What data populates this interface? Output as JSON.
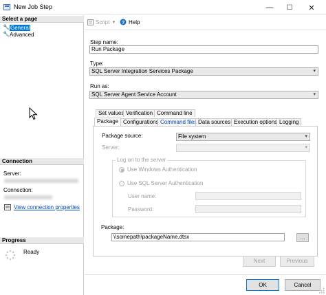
{
  "window": {
    "title": "New Job Step",
    "minimize": "—",
    "maximize": "☐",
    "close": "✕"
  },
  "left": {
    "select_page_header": "Select a page",
    "pages": [
      {
        "label": "General"
      },
      {
        "label": "Advanced"
      }
    ],
    "connection_header": "Connection",
    "server_label": "Server:",
    "connection_label": "Connection:",
    "view_connection_link": "View connection properties",
    "progress_header": "Progress",
    "progress_status": "Ready"
  },
  "toolbar": {
    "script_label": "Script",
    "help_label": "Help"
  },
  "form": {
    "step_name_label": "Step name:",
    "step_name_value": "Run Package",
    "type_label": "Type:",
    "type_value": "SQL Server Integration Services Package",
    "run_as_label": "Run as:",
    "run_as_value": "SQL Server Agent Service Account"
  },
  "tabs_row1": [
    "Set values",
    "Verification",
    "Command line"
  ],
  "tabs_row2": [
    "Package",
    "Configurations",
    "Command files",
    "Data sources",
    "Execution options",
    "Logging"
  ],
  "package_tab": {
    "package_source_label": "Package source:",
    "package_source_value": "File system",
    "server_label": "Server:",
    "logon_group_label": "Log on to the server",
    "windows_auth_label": "Use Windows Authentication",
    "sql_auth_label": "Use SQL Server Authentication",
    "user_name_label": "User name:",
    "password_label": "Password:",
    "package_label": "Package:",
    "package_value": "\\\\somepath\\packageName.dtsx",
    "browse_label": "..."
  },
  "buttons": {
    "next": "Next",
    "previous": "Previous",
    "ok": "OK",
    "cancel": "Cancel"
  }
}
